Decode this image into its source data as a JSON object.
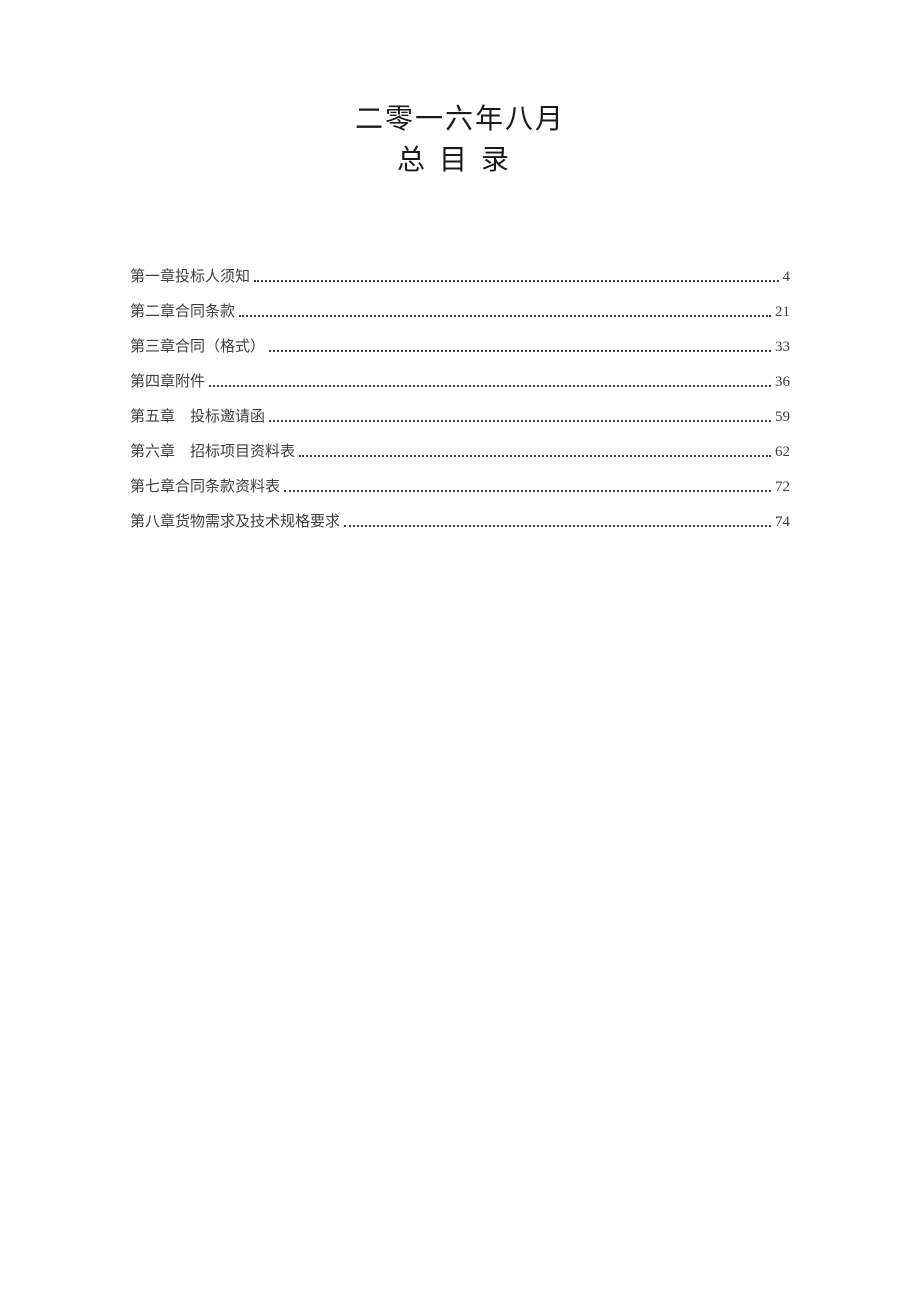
{
  "header": {
    "date": "二零一六年八月",
    "toc_title": "总目录"
  },
  "toc": {
    "entries": [
      {
        "label": "第一章投标人须知",
        "page": "4"
      },
      {
        "label": "第二章合同条款",
        "page": "21"
      },
      {
        "label": "第三章合同（格式）",
        "page": "33"
      },
      {
        "label": "第四章附件",
        "page": "36"
      },
      {
        "label": "第五章　投标邀请函",
        "page": "59"
      },
      {
        "label": "第六章　招标项目资料表",
        "page": "62"
      },
      {
        "label": "第七章合同条款资料表",
        "page": "72"
      },
      {
        "label": "第八章货物需求及技术规格要求",
        "page": "74"
      }
    ]
  }
}
